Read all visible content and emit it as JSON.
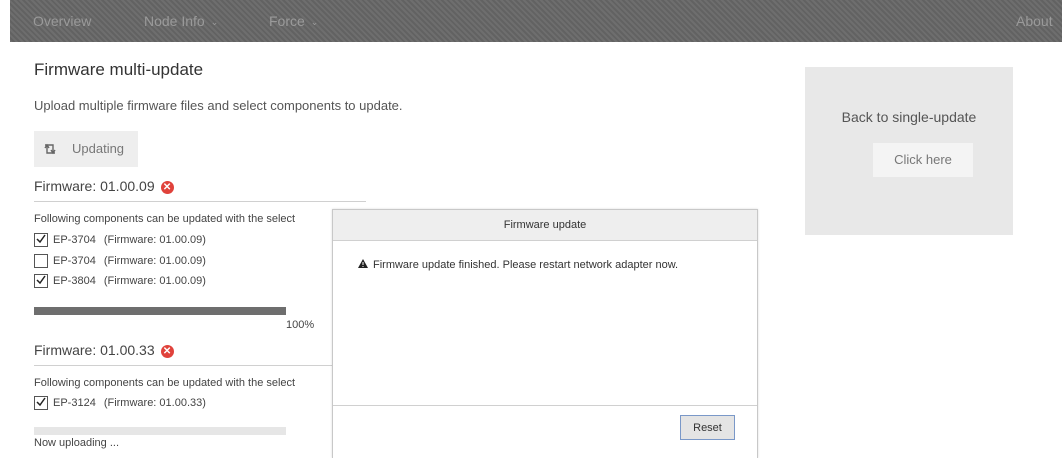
{
  "nav": {
    "overview": "Overview",
    "node_info": "Node Info",
    "force": "Force",
    "about": "About",
    "caret": "⌄"
  },
  "page": {
    "title": "Firmware multi-update",
    "subtitle": "Upload multiple firmware files and select components to update.",
    "updating_label": "Updating",
    "updating_icon": "sync-icon"
  },
  "firmware_groups": [
    {
      "label": "Firmware: 01.00.09",
      "intro": "Following components can be updated with the select",
      "components": [
        {
          "name": "EP-3704",
          "firmware": "(Firmware: 01.00.09)",
          "checked": true
        },
        {
          "name": "EP-3704",
          "firmware": "(Firmware: 01.00.09)",
          "checked": false
        },
        {
          "name": "EP-3804",
          "firmware": "(Firmware: 01.00.09)",
          "checked": true
        }
      ],
      "progress": 1.0,
      "progress_text": "100%"
    },
    {
      "label": "Firmware: 01.00.33",
      "intro": "Following components can be updated with the select",
      "components": [
        {
          "name": "EP-3124",
          "firmware": "(Firmware: 01.00.33)",
          "checked": true
        }
      ],
      "progress": 0.0,
      "status": "Now uploading ..."
    }
  ],
  "side_panel": {
    "title": "Back to single-update",
    "button": "Click here"
  },
  "modal": {
    "title": "Firmware update",
    "message": "Firmware update finished. Please restart network adapter now.",
    "reset": "Reset"
  },
  "colors": {
    "navbar": "#666666",
    "error": "#e0423b",
    "progress_fill": "#6e6e6e"
  }
}
